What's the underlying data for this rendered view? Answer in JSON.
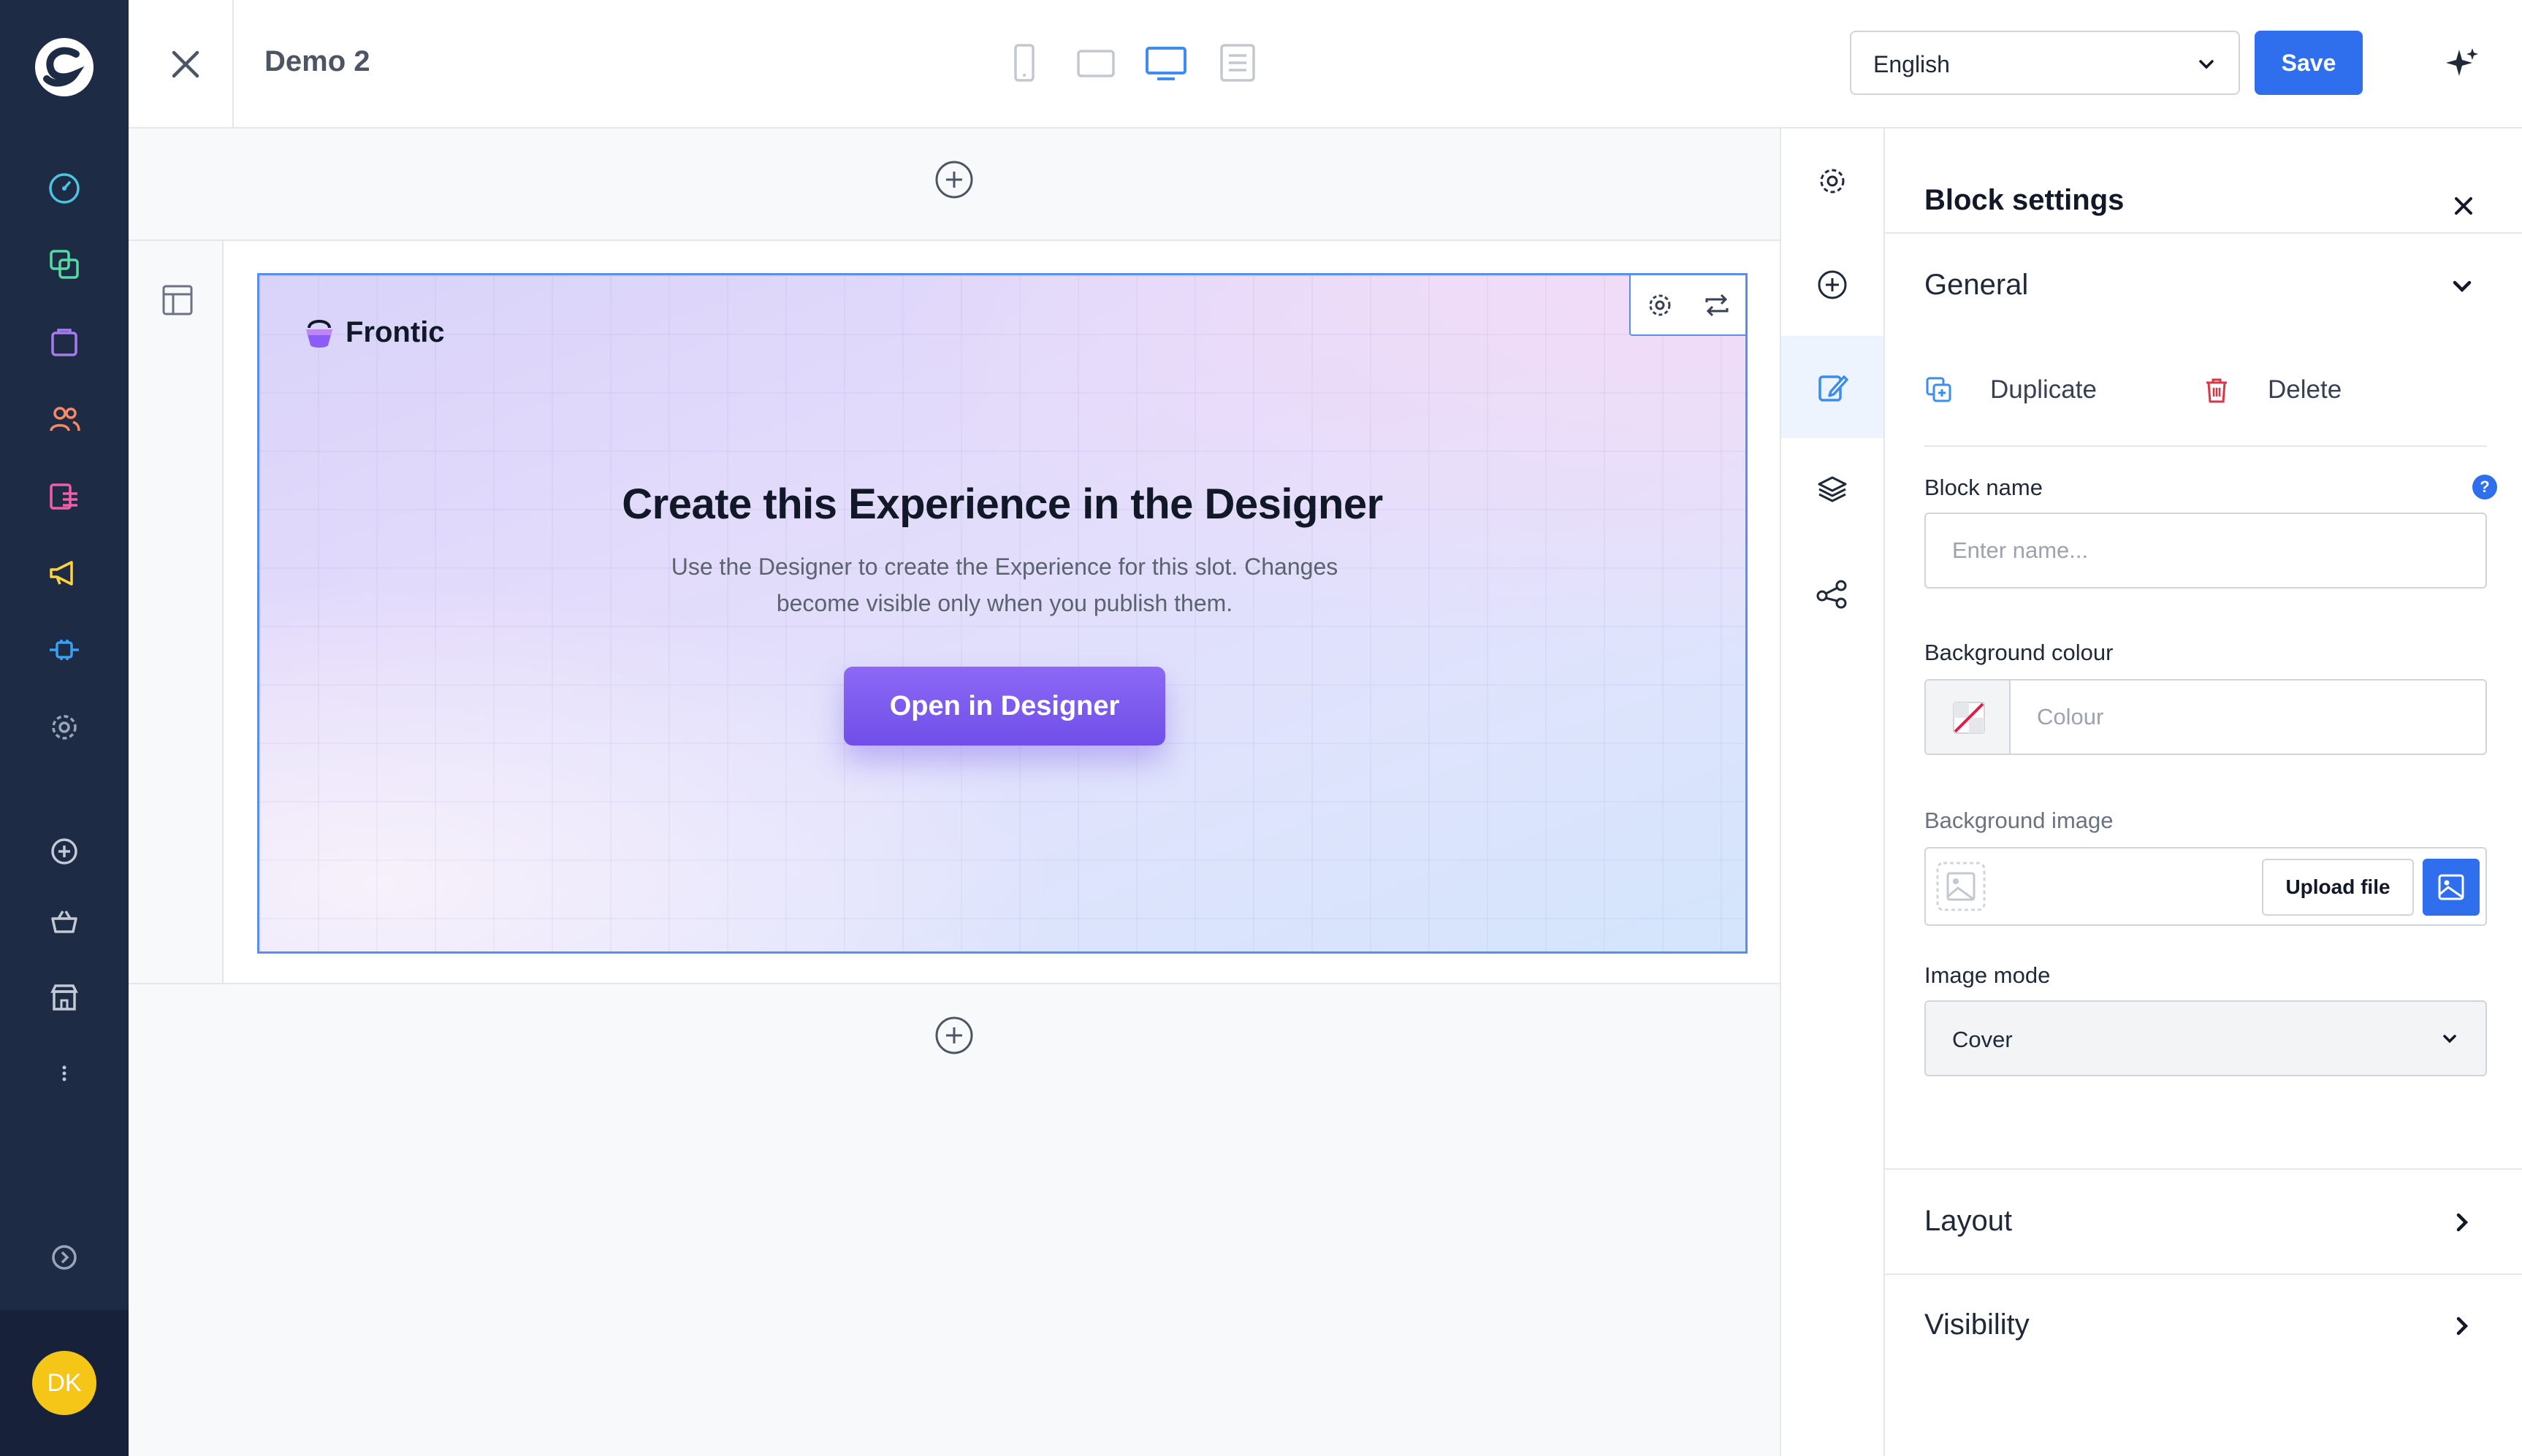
{
  "app": {
    "user_initials": "DK"
  },
  "nav": {
    "items": [
      {
        "icon": "dashboard-icon",
        "color": "#4ec3e0"
      },
      {
        "icon": "catalogues-icon",
        "color": "#57d9a3"
      },
      {
        "icon": "orders-icon",
        "color": "#a57cf0"
      },
      {
        "icon": "customers-icon",
        "color": "#f58a65"
      },
      {
        "icon": "content-icon",
        "color": "#ef5fa7"
      },
      {
        "icon": "marketing-icon",
        "color": "#ffd23f"
      },
      {
        "icon": "extensions-icon",
        "color": "#3aa0f2"
      },
      {
        "icon": "settings-icon",
        "color": "#9aa5b8"
      },
      {
        "icon": "add-icon",
        "color": "#9aa5b8"
      },
      {
        "icon": "basket-icon",
        "color": "#9aa5b8"
      },
      {
        "icon": "store-icon",
        "color": "#9aa5b8"
      },
      {
        "icon": "more-icon",
        "color": "#9aa5b8"
      },
      {
        "icon": "expand-icon",
        "color": "#9aa5b8"
      }
    ]
  },
  "topbar": {
    "title": "Demo 2",
    "language": "English",
    "save_label": "Save",
    "devices": [
      "mobile",
      "tablet",
      "desktop",
      "form"
    ],
    "active_device": "desktop"
  },
  "block": {
    "brand_name": "Frontic",
    "heading": "Create this Experience in the Designer",
    "description": "Use the Designer to create the Experience for this slot. Changes become visible only when you publish them.",
    "button_label": "Open in Designer"
  },
  "rail": {
    "items": [
      "settings",
      "add",
      "edit-block",
      "layers",
      "connections"
    ],
    "active": "edit-block"
  },
  "panel": {
    "title": "Block settings",
    "general_label": "General",
    "duplicate_label": "Duplicate",
    "delete_label": "Delete",
    "block_name_label": "Block name",
    "block_name_placeholder": "Enter name...",
    "help_badge": "?",
    "bg_colour_label": "Background colour",
    "bg_colour_placeholder": "Colour",
    "bg_image_label": "Background image",
    "upload_label": "Upload file",
    "image_mode_label": "Image mode",
    "image_mode_value": "Cover",
    "layout_label": "Layout",
    "visibility_label": "Visibility"
  },
  "colors": {
    "accent": "#2f6fed",
    "nav_bg": "#1e2b45",
    "cta_purple": "#7457ec",
    "delete_red": "#dc3545"
  }
}
